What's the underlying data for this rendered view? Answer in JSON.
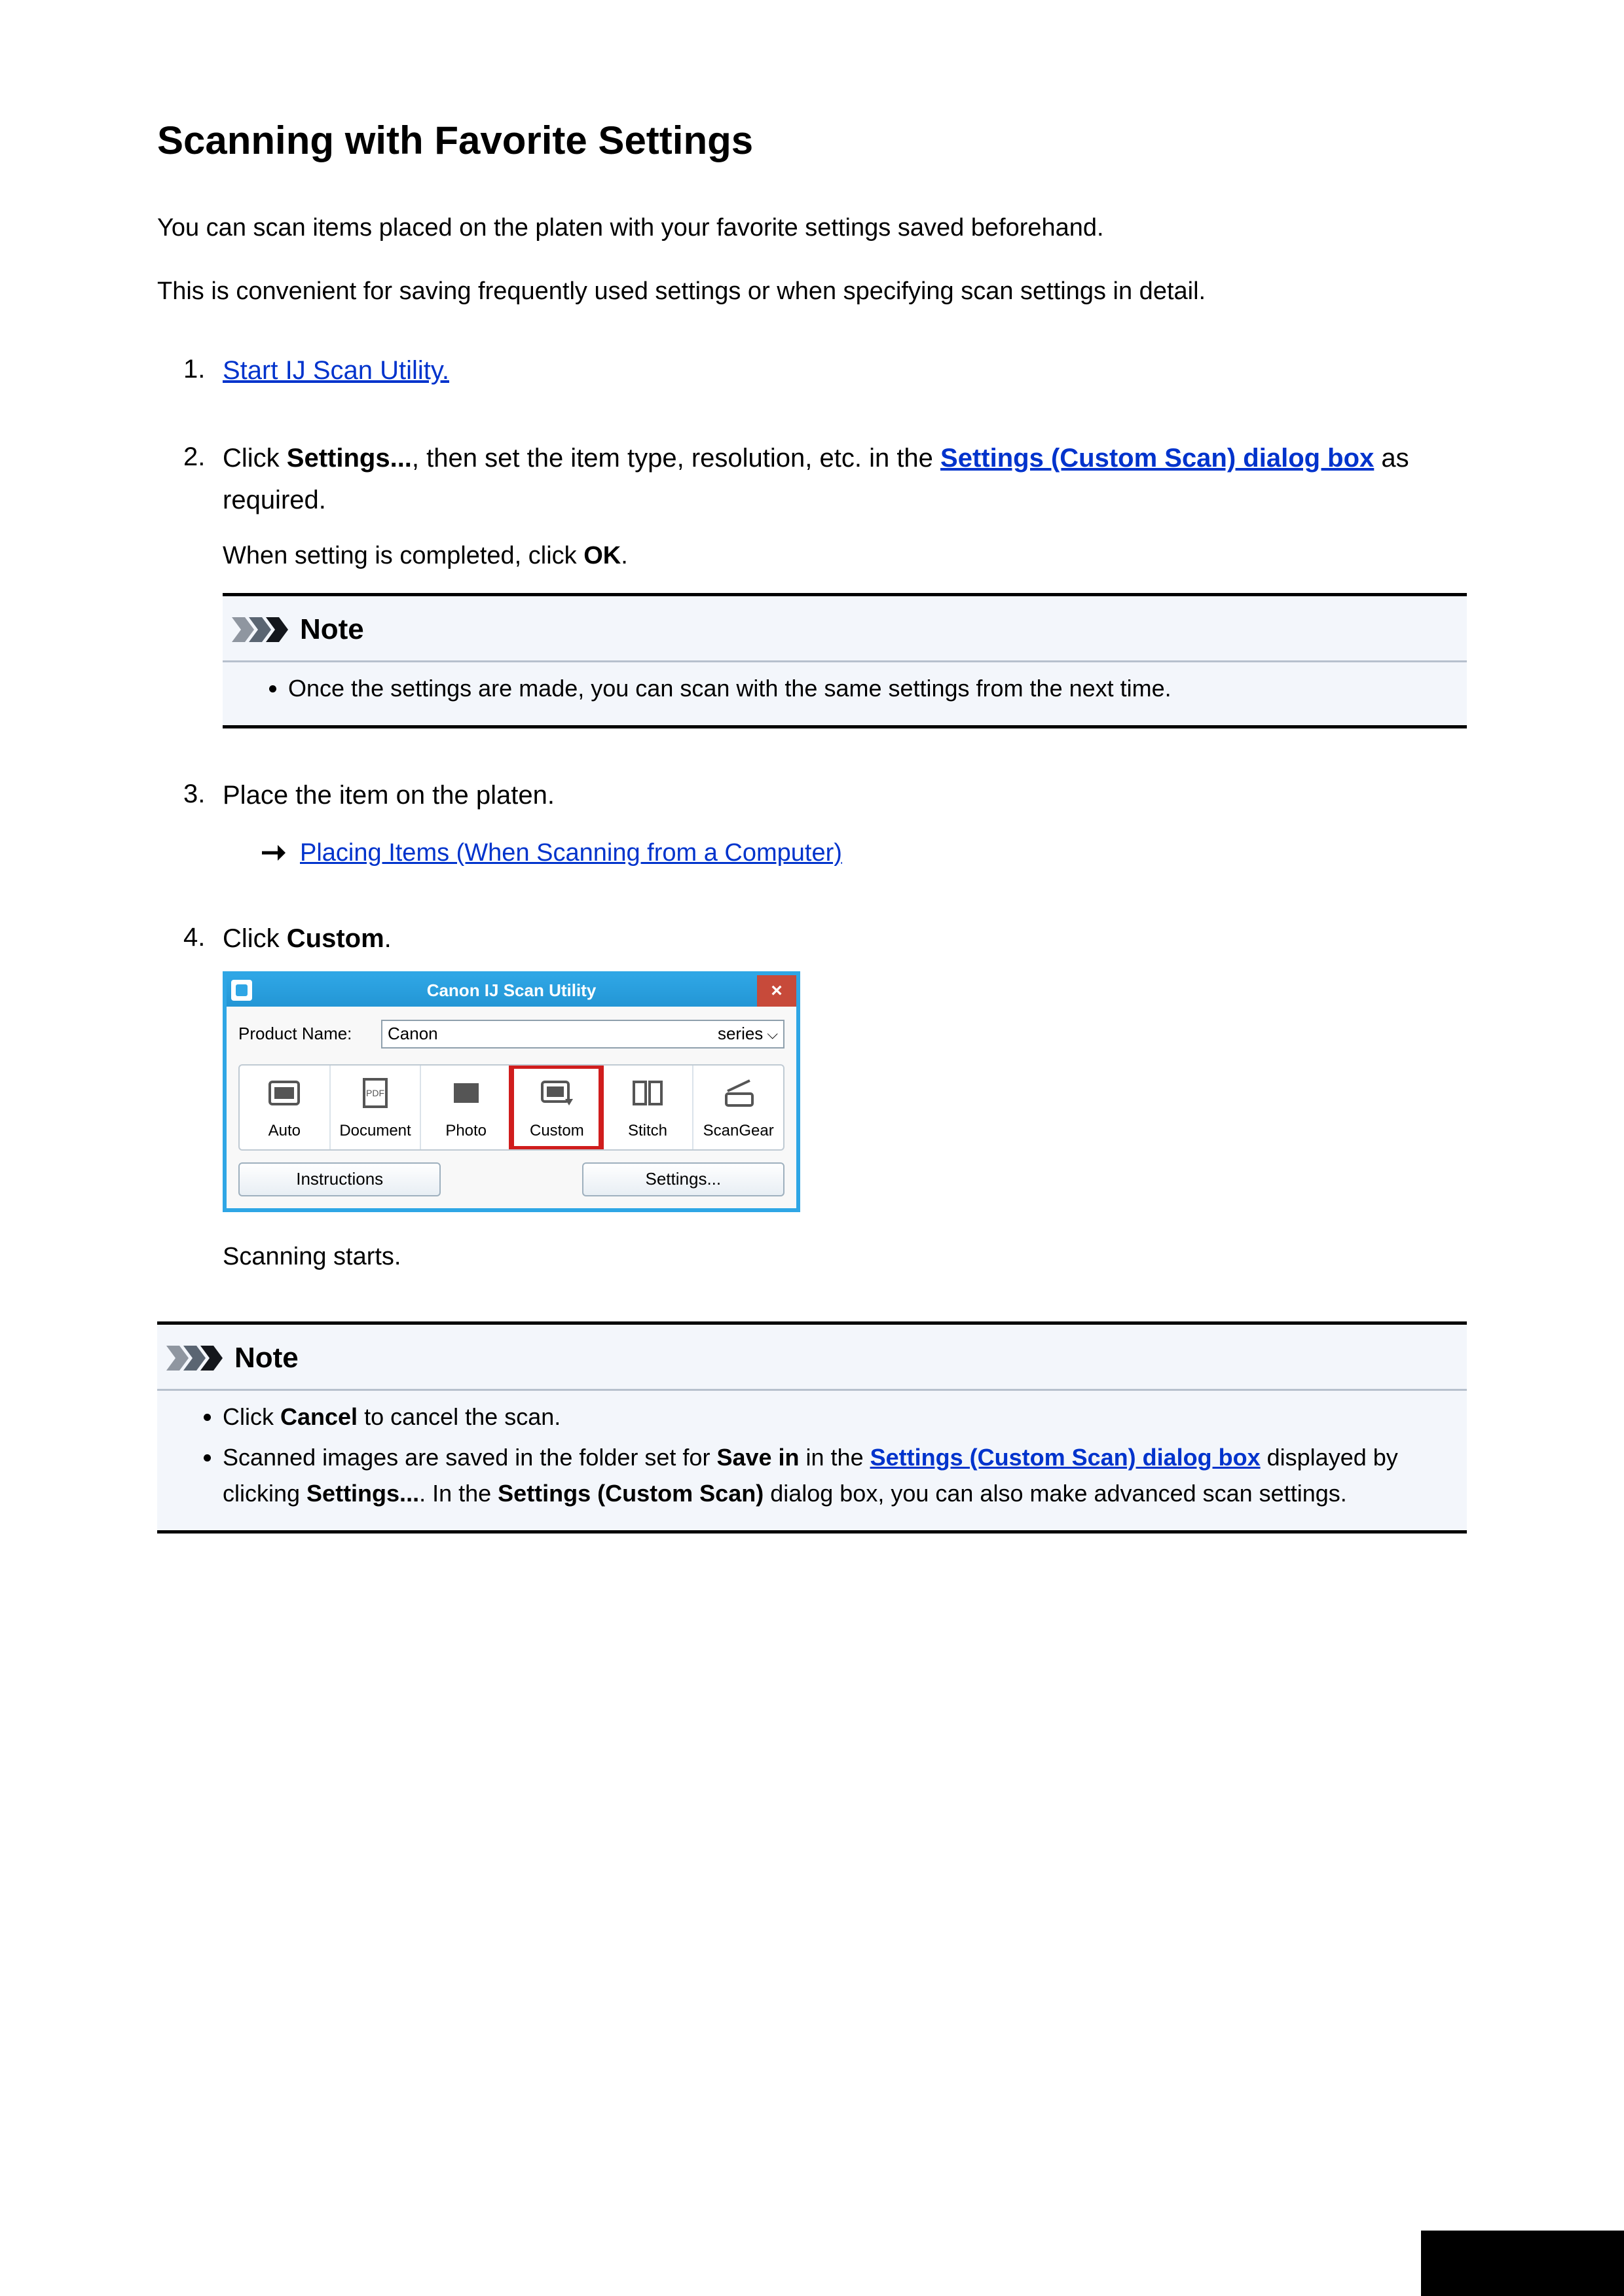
{
  "title": "Scanning with Favorite Settings",
  "intro1": "You can scan items placed on the platen with your favorite settings saved beforehand.",
  "intro2": "This is convenient for saving frequently used settings or when specifying scan settings in detail.",
  "steps": {
    "s1": {
      "num": "1.",
      "link": "Start IJ Scan Utility."
    },
    "s2": {
      "num": "2.",
      "t_click": "Click ",
      "t_settings": "Settings...",
      "t_mid": ", then set the item type, resolution, etc. in the ",
      "link": "Settings (Custom Scan) dialog box",
      "t_tail": " as required.",
      "detail_pre": "When setting is completed, click ",
      "detail_ok": "OK",
      "detail_post": "."
    },
    "s3": {
      "num": "3.",
      "text": "Place the item on the platen.",
      "sublink": "Placing Items (When Scanning from a Computer)"
    },
    "s4": {
      "num": "4.",
      "pre": "Click ",
      "word": "Custom",
      "post": ".",
      "after": "Scanning starts."
    }
  },
  "note1": {
    "label": "Note",
    "item": "Once the settings are made, you can scan with the same settings from the next time."
  },
  "note2": {
    "label": "Note",
    "i1_pre": "Click ",
    "i1_b": "Cancel",
    "i1_post": " to cancel the scan.",
    "i2_pre": "Scanned images are saved in the folder set for ",
    "i2_b1": "Save in",
    "i2_mid": " in the ",
    "i2_link": "Settings (Custom Scan) dialog box",
    "i2_post1": " displayed by clicking ",
    "i2_b2": "Settings...",
    "i2_post2": ". In the ",
    "i2_b3": "Settings (Custom Scan)",
    "i2_post3": " dialog box, you can also make advanced scan settings."
  },
  "app": {
    "title": "Canon IJ Scan Utility",
    "product_label": "Product Name:",
    "product_left": "Canon",
    "product_right": "series",
    "tools": {
      "auto": "Auto",
      "document": "Document",
      "photo": "Photo",
      "custom": "Custom",
      "stitch": "Stitch",
      "scangear": "ScanGear"
    },
    "instructions": "Instructions",
    "settings_btn": "Settings..."
  }
}
